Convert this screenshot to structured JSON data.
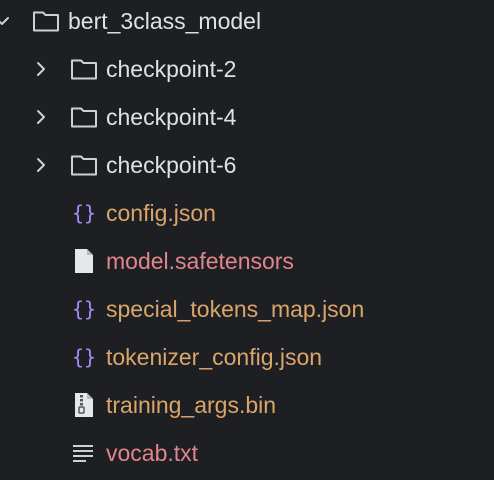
{
  "tree": {
    "root": {
      "label": "bert_3class_model",
      "expanded": true,
      "icon": "folder-icon"
    },
    "folders": [
      {
        "label": "checkpoint-2",
        "expanded": false,
        "icon": "folder-icon"
      },
      {
        "label": "checkpoint-4",
        "expanded": false,
        "icon": "folder-icon"
      },
      {
        "label": "checkpoint-6",
        "expanded": false,
        "icon": "folder-icon"
      }
    ],
    "files": [
      {
        "label": "config.json",
        "icon": "json-braces-icon",
        "status_color": "#d9a56b"
      },
      {
        "label": "model.safetensors",
        "icon": "blank-file-icon",
        "status_color": "#e0868b"
      },
      {
        "label": "special_tokens_map.json",
        "icon": "json-braces-icon",
        "status_color": "#d9a56b"
      },
      {
        "label": "tokenizer_config.json",
        "icon": "json-braces-icon",
        "status_color": "#d9a56b"
      },
      {
        "label": "training_args.bin",
        "icon": "binary-file-icon",
        "status_color": "#d9a56b"
      },
      {
        "label": "vocab.txt",
        "icon": "text-lines-icon",
        "status_color": "#e0868b"
      }
    ]
  },
  "colors": {
    "background": "#1e1f22",
    "default_text": "#dfe1e5",
    "modified_text": "#d9a56b",
    "unversioned_text": "#e0868b",
    "json_icon": "#a78bfa",
    "icon_stroke": "#ced0d6"
  }
}
